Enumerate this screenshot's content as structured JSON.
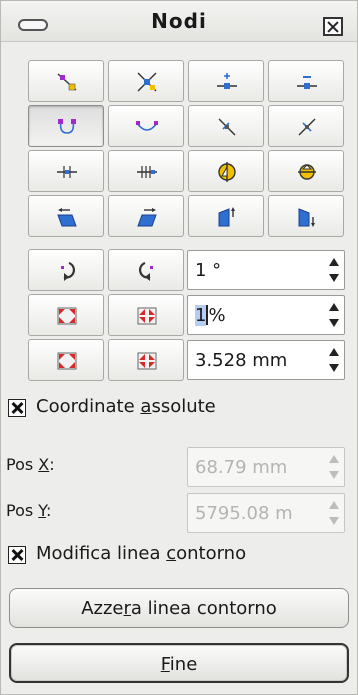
{
  "window": {
    "title": "Nodi"
  },
  "tools": [
    [
      "tool-select-points-icon",
      "tool-insert-points-icon",
      "tool-move-points-icon",
      "tool-delete-points-icon"
    ],
    [
      "tool-curve-icon",
      "tool-convert-curve-icon",
      "tool-split-curve-icon",
      "tool-close-curve-icon"
    ],
    [
      "tool-symmetric-node-icon",
      "tool-smooth-node-icon",
      "tool-rotate-mirror-icon",
      "tool-flip-icon"
    ],
    [
      "tool-slant-left-icon",
      "tool-slant-right-icon",
      "tool-distort-up-icon",
      "tool-distort-down-icon"
    ],
    [
      "tool-rotate-left-icon",
      "tool-rotate-right-icon"
    ],
    [
      "tool-scale-out-icon",
      "tool-scale-in-icon"
    ],
    [
      "tool-expand-icon",
      "tool-shrink-icon"
    ]
  ],
  "fields": {
    "angle": {
      "value": "1 °"
    },
    "percent": {
      "selected": "1",
      "rest": "%"
    },
    "distance": {
      "value": "3.528 mm"
    }
  },
  "absolute": {
    "before": "Coordinate ",
    "key": "a",
    "after": "ssolute",
    "checked": true
  },
  "pos_x": {
    "before": "Pos ",
    "key": "X",
    "after": ":",
    "value": "68.79 mm"
  },
  "pos_y": {
    "before": "Pos ",
    "key": "Y",
    "after": ":",
    "value": "5795.08 m"
  },
  "modify": {
    "before": "Modifica linea ",
    "key": "c",
    "after": "ontorno",
    "checked": true
  },
  "reset_button": {
    "before": "Azze",
    "key": "r",
    "after": "a linea contorno"
  },
  "done_button": {
    "before": "",
    "key": "F",
    "after": "ine"
  },
  "colors": {
    "accent_blue": "#2f6fd0",
    "node_purple": "#a02ad0",
    "node_yellow": "#f0c000",
    "selection": "#b5cdf1"
  }
}
